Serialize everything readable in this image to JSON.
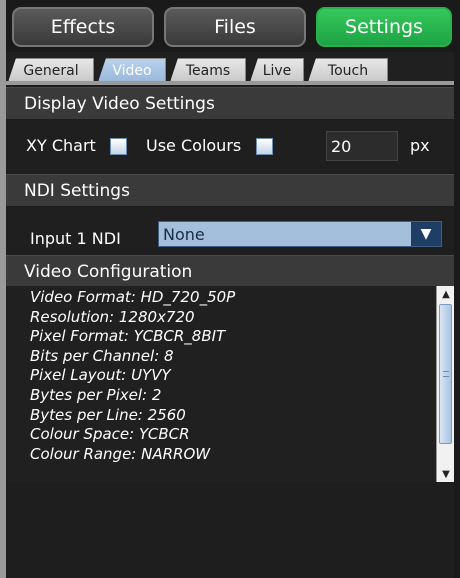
{
  "top_buttons": [
    {
      "label": "Effects"
    },
    {
      "label": "Files"
    },
    {
      "label": "Settings"
    }
  ],
  "tabs": [
    {
      "label": "General"
    },
    {
      "label": "Video"
    },
    {
      "label": "Teams"
    },
    {
      "label": "Live"
    },
    {
      "label": "Touch"
    }
  ],
  "display_video": {
    "heading": "Display Video Settings",
    "xy_chart_label": "XY Chart",
    "use_colours_label": "Use Colours",
    "size_value": "20",
    "size_unit": "px"
  },
  "ndi": {
    "heading": "NDI Settings",
    "input_label": "Input 1 NDI",
    "input_value": "None"
  },
  "video_config": {
    "heading": "Video Configuration",
    "lines": [
      "Video Format: HD_720_50P",
      "Resolution: 1280x720",
      "Pixel Format: YCBCR_8BIT",
      "Bits per Channel: 8",
      "Pixel Layout: UYVY",
      "Bytes per Pixel: 2",
      "Bytes per Line: 2560",
      "Colour Space: YCBCR",
      "Colour Range: NARROW"
    ]
  },
  "colors": {
    "accent_green": "#2ab04e",
    "selected_tab": "#a9c5e6",
    "select_bg": "#a3bfdc"
  }
}
